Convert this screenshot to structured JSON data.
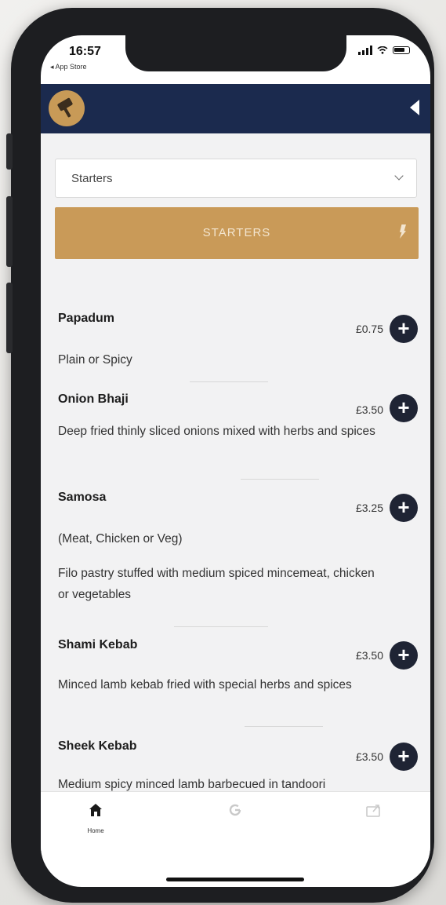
{
  "status_bar": {
    "time": "16:57",
    "back_label": "◂ App Store"
  },
  "header": {
    "logo_icon": "chef-hat-logo-icon",
    "right_icon": "caret-left-icon"
  },
  "category_select": {
    "selected": "Starters"
  },
  "category_banner": {
    "title": "STARTERS"
  },
  "menu_items": [
    {
      "name": "Papadum",
      "price": "£0.75",
      "descriptions": [
        "Plain or Spicy"
      ]
    },
    {
      "name": "Onion Bhaji",
      "price": "£3.50",
      "descriptions": [
        "Deep fried thinly sliced onions mixed with herbs and spices"
      ]
    },
    {
      "name": "Samosa",
      "price": "£3.25",
      "descriptions": [
        "(Meat, Chicken or Veg)",
        "Filo pastry stuffed with medium spiced mincemeat, chicken or vegetables"
      ]
    },
    {
      "name": "Shami Kebab",
      "price": "£3.50",
      "descriptions": [
        "Minced lamb kebab fried with special herbs and spices"
      ]
    },
    {
      "name": "Sheek Kebab",
      "price": "£3.50",
      "descriptions": [
        "Medium spicy minced lamb barbecued in tandoori"
      ]
    }
  ],
  "tab_bar": {
    "tabs": [
      {
        "label": "Home",
        "icon": "home-icon",
        "active": true
      },
      {
        "label": "",
        "icon": "google-icon",
        "active": false
      },
      {
        "label": "",
        "icon": "share-icon",
        "active": false
      }
    ]
  },
  "colors": {
    "header_bg": "#1b2a4e",
    "accent_gold": "#c99a58",
    "add_button": "#1f2434"
  }
}
